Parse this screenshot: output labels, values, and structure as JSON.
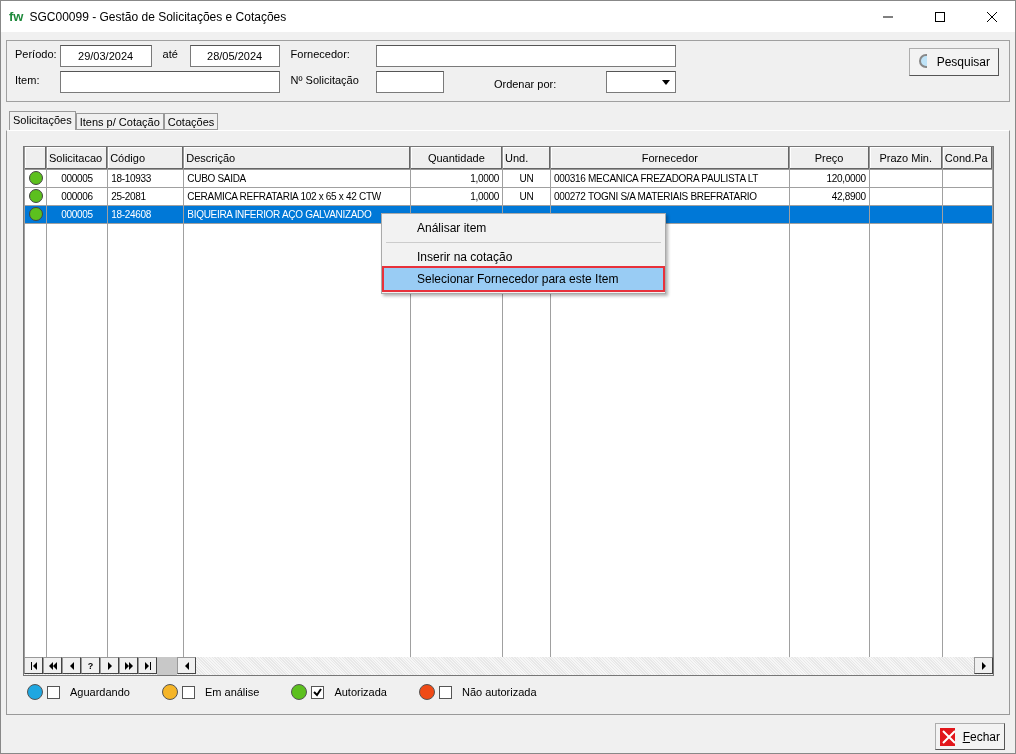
{
  "window": {
    "title": "SGC00099 - Gestão de Solicitações e Cotações",
    "logo": "fw"
  },
  "filters": {
    "periodo_label": "Período:",
    "periodo_from": "29/03/2024",
    "ate_label": "até",
    "periodo_to": "28/05/2024",
    "fornecedor_label": "Fornecedor:",
    "item_label": "Item:",
    "solicitacao_label": "Nº Solicitação",
    "ordenar_label": "Ordenar por:",
    "search_button": "Pesquisar"
  },
  "tabs": [
    {
      "label": "Solicitações",
      "selected": true
    },
    {
      "label": "Itens p/ Cotação",
      "selected": false
    },
    {
      "label": "Cotações",
      "selected": false
    }
  ],
  "table": {
    "columns": [
      "Solicitacao",
      "Código",
      "Descrição",
      "Quantidade",
      "Und.",
      "Fornecedor",
      "Preço",
      "Prazo Min.",
      "Cond.Pa"
    ],
    "rows": [
      {
        "color": "#5cc01e",
        "selected": false,
        "cells": [
          "000005",
          "18-10933",
          "CUBO SAIDA",
          "1,0000",
          "UN",
          "000316  MECANICA FREZADORA PAULISTA LT",
          "120,0000",
          "",
          ""
        ]
      },
      {
        "color": "#5cc01e",
        "selected": false,
        "cells": [
          "000006",
          "25-2081",
          "CERAMICA REFRATARIA 102 x 65 x 42 CTW",
          "1,0000",
          "UN",
          "000272  TOGNI S/A MATERIAIS BREFRATARIO",
          "42,8900",
          "",
          ""
        ]
      },
      {
        "color": "#5cc01e",
        "selected": true,
        "cells": [
          "000005",
          "18-24608",
          "BIQUEIRA INFERIOR AÇO GALVANIZADO",
          "",
          "",
          "",
          "",
          "",
          ""
        ]
      }
    ]
  },
  "context_menu": [
    {
      "label": "Análisar item",
      "selected": false
    },
    {
      "label": "Inserir na cotação",
      "selected": false
    },
    {
      "label": "Selecionar Fornecedor para este Item",
      "selected": true
    }
  ],
  "navigator": {
    "help": "?"
  },
  "legend": [
    {
      "label": "Aguardando",
      "color": "#1ea7e1",
      "checked": false
    },
    {
      "label": "Em análise",
      "color": "#f5b528",
      "checked": false
    },
    {
      "label": "Autorizada",
      "color": "#5cc01e",
      "checked": true
    },
    {
      "label": "Não autorizada",
      "color": "#f04a16",
      "checked": false
    }
  ],
  "close_button": "Fechar"
}
